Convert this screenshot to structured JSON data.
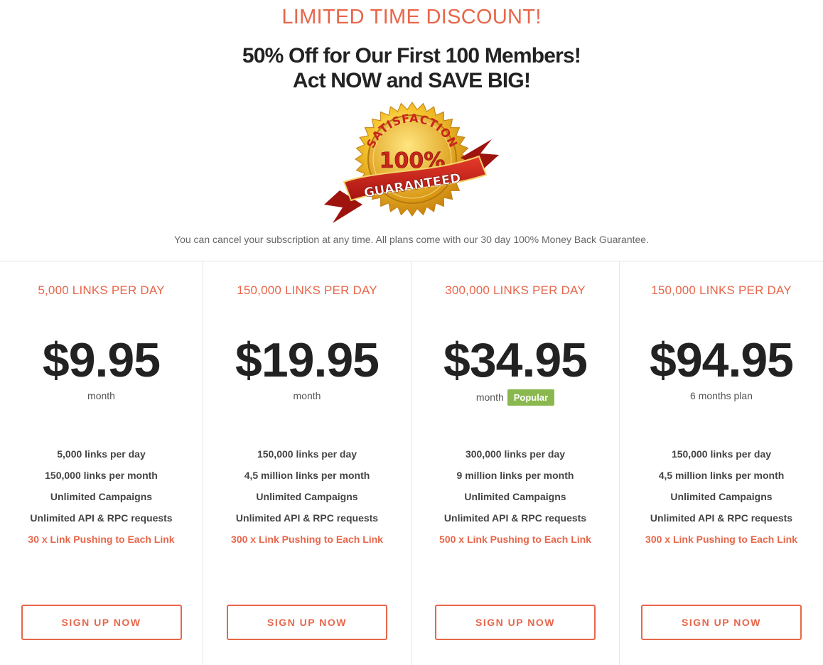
{
  "promo": {
    "headline": "LIMITED TIME DISCOUNT!",
    "subline1": "50% Off for Our First 100 Members!",
    "subline2": "Act NOW and SAVE BIG!",
    "seal": {
      "arc": "SATISFACTION",
      "percent": "100%",
      "banner": "GUARANTEED"
    },
    "note": "You can cancel your subscription at any time. All plans come with our 30 day 100% Money Back Guarantee."
  },
  "colors": {
    "accent": "#e8664a",
    "badge": "#8ab84e",
    "price": "#222222"
  },
  "plans": [
    {
      "title": "5,000 LINKS PER DAY",
      "price": "$9.95",
      "period": "month",
      "features": [
        "5,000 links per day",
        "150,000 links per month",
        "Unlimited Campaigns",
        "Unlimited API & RPC requests",
        "30 x Link Pushing to Each Link"
      ],
      "button": "SIGN UP NOW"
    },
    {
      "title": "150,000 LINKS PER DAY",
      "price": "$19.95",
      "period": "month",
      "features": [
        "150,000 links per day",
        "4,5 million links per month",
        "Unlimited Campaigns",
        "Unlimited API & RPC requests",
        "300 x Link Pushing to Each Link"
      ],
      "button": "SIGN UP NOW"
    },
    {
      "title": "300,000 LINKS PER DAY",
      "price": "$34.95",
      "period": "month",
      "badge": "Popular",
      "features": [
        "300,000 links per day",
        "9 million links per month",
        "Unlimited Campaigns",
        "Unlimited API & RPC requests",
        "500 x Link Pushing to Each Link"
      ],
      "button": "SIGN UP NOW"
    },
    {
      "title": "150,000 LINKS PER DAY",
      "price": "$94.95",
      "period": "6 months plan",
      "features": [
        "150,000 links per day",
        "4,5 million links per month",
        "Unlimited Campaigns",
        "Unlimited API & RPC requests",
        "300 x Link Pushing to Each Link"
      ],
      "button": "SIGN UP NOW"
    }
  ]
}
